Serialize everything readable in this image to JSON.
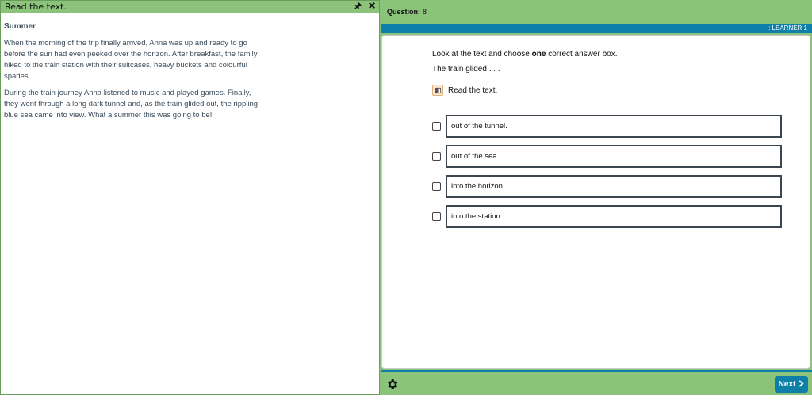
{
  "reading": {
    "header_title": "Read the text.",
    "title": "Summer",
    "paragraphs": [
      "When the morning of the trip finally arrived, Anna was up and ready to go before the sun had even peeked over the horizon. After breakfast, the family hiked to the train station with their suitcases, heavy buckets and colourful spades.",
      "During the train journey Anna listened to music and played games. Finally, they went through a long dark tunnel and, as the train glided out, the rippling blue sea came into view. What a summer this was going to be!"
    ]
  },
  "top_bar": {
    "question_label": "Question:",
    "question_number": "8"
  },
  "learner_bar": {
    "text": ": LEARNER 1"
  },
  "question": {
    "instruction_pre": "Look at the text and choose",
    "instruction_bold": "one",
    "instruction_post": "correct answer box.",
    "stem": "The train glided . . .",
    "read_link": "Read the text.",
    "options": [
      {
        "label": "out of the tunnel.",
        "checked": false
      },
      {
        "label": "out of the sea.",
        "checked": false
      },
      {
        "label": "into the horizon.",
        "checked": false
      },
      {
        "label": "into the station.",
        "checked": false
      }
    ]
  },
  "bottom_bar": {
    "next_label": "Next"
  },
  "icons": {
    "pin": "pin-icon",
    "close": "close-icon",
    "book": "book-icon",
    "settings": "gear-icon",
    "next_arrow": "chevron-right-icon"
  },
  "colors": {
    "green": "#8bc37b",
    "blue": "#0d7fa8"
  }
}
